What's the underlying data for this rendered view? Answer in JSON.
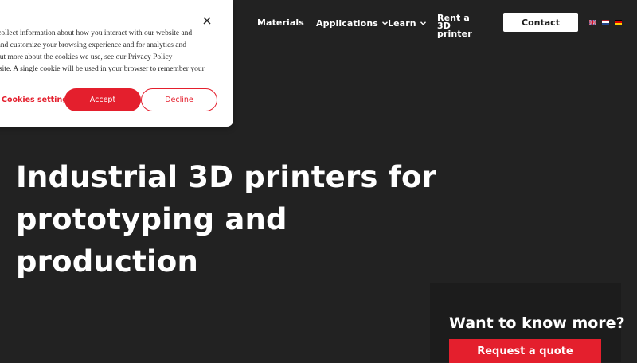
{
  "nav": {
    "materials": "Materials",
    "applications": "Applications",
    "learn": "Learn",
    "rent": "Rent a 3D printer",
    "contact": "Contact",
    "chevron_icon": "chevron-down-icon",
    "flags": [
      "uk-flag-icon",
      "nl-flag-icon",
      "de-flag-icon"
    ]
  },
  "hero": {
    "title_line1": "Industrial 3D printers for",
    "title_line2": "prototyping and production"
  },
  "cta_box": {
    "title": "Want to know more?",
    "button": "Request a quote"
  },
  "cookie_banner": {
    "lines": [
      "o collect information about how you interact with our website and",
      "e and customize your browsing experience and for analytics and",
      "l out more about the cookies we use, see our Privacy Policy",
      "ebsite. A single cookie will be used in your browser to remember your"
    ],
    "settings_link": "Cookies settings",
    "accept": "Accept",
    "decline": "Decline",
    "close_icon": "close-icon"
  },
  "colors": {
    "background": "#222222",
    "accent": "#e41f2d",
    "text": "#ffffff"
  }
}
